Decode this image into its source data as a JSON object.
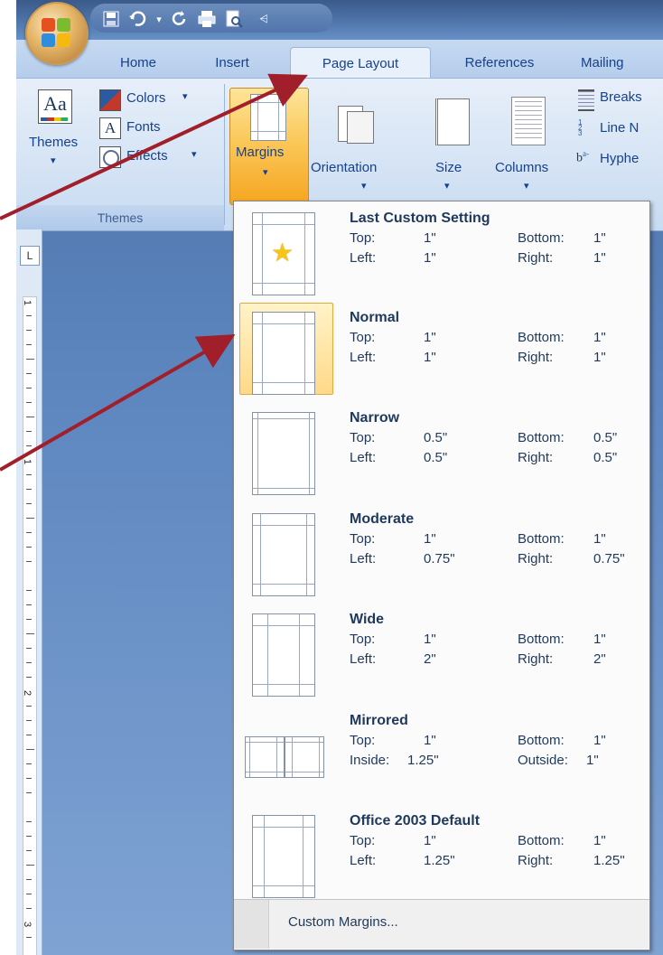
{
  "tabs": [
    "Home",
    "Insert",
    "Page Layout",
    "References",
    "Mailing"
  ],
  "ribbon": {
    "themes_label": "Themes",
    "colors_label": "Colors",
    "fonts_label": "Fonts",
    "effects_label": "Effects",
    "group_caption": "Themes",
    "margins_label": "Margins",
    "orientation_label": "Orientation",
    "size_label": "Size",
    "columns_label": "Columns",
    "breaks_label": "Breaks",
    "line_numbers_label": "Line N",
    "hyphenation_label": "Hyphe"
  },
  "margins_menu": {
    "items": [
      {
        "title": "Last Custom Setting",
        "l1a": "Top:",
        "l1b": "1\"",
        "l1c": "Bottom:",
        "l1d": "1\"",
        "l2a": "Left:",
        "l2b": "1\"",
        "l2c": "Right:",
        "l2d": "1\""
      },
      {
        "title": "Normal",
        "l1a": "Top:",
        "l1b": "1\"",
        "l1c": "Bottom:",
        "l1d": "1\"",
        "l2a": "Left:",
        "l2b": "1\"",
        "l2c": "Right:",
        "l2d": "1\""
      },
      {
        "title": "Narrow",
        "l1a": "Top:",
        "l1b": "0.5\"",
        "l1c": "Bottom:",
        "l1d": "0.5\"",
        "l2a": "Left:",
        "l2b": "0.5\"",
        "l2c": "Right:",
        "l2d": "0.5\""
      },
      {
        "title": "Moderate",
        "l1a": "Top:",
        "l1b": "1\"",
        "l1c": "Bottom:",
        "l1d": "1\"",
        "l2a": "Left:",
        "l2b": "0.75\"",
        "l2c": "Right:",
        "l2d": "0.75\""
      },
      {
        "title": "Wide",
        "l1a": "Top:",
        "l1b": "1\"",
        "l1c": "Bottom:",
        "l1d": "1\"",
        "l2a": "Left:",
        "l2b": "2\"",
        "l2c": "Right:",
        "l2d": "2\""
      },
      {
        "title": "Mirrored",
        "l1a": "Top:",
        "l1b": "1\"",
        "l1c": "Bottom:",
        "l1d": "1\"",
        "l2a": "Inside:",
        "l2b": "1.25\"",
        "l2c": "Outside:",
        "l2d": "1\""
      },
      {
        "title": "Office 2003 Default",
        "l1a": "Top:",
        "l1b": "1\"",
        "l1c": "Bottom:",
        "l1d": "1\"",
        "l2a": "Left:",
        "l2b": "1.25\"",
        "l2c": "Right:",
        "l2d": "1.25\""
      }
    ],
    "custom_label": "Custom Margins..."
  },
  "ruler": {
    "label_1": "1",
    "label_2": "2",
    "label_3": "3"
  }
}
